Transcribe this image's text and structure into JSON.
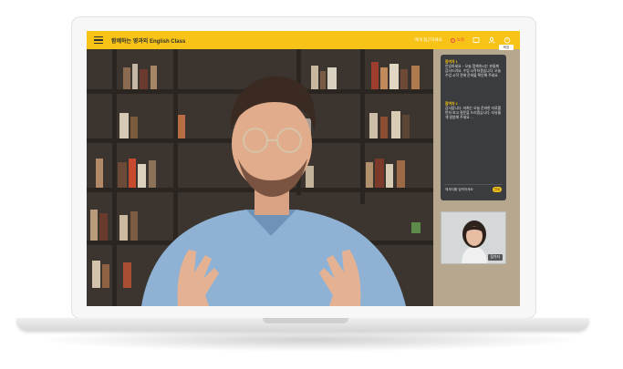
{
  "app": {
    "title": "함께하는 영과외 English Class",
    "menu_icon": "hamburger-menu-icon"
  },
  "topbar": {
    "status_text": "에게 접근하세요",
    "record_label": "녹화",
    "icons": [
      "screen-share-icon",
      "user-icon",
      "power-icon"
    ],
    "exit_label": "퇴장"
  },
  "chat": {
    "messages": [
      {
        "name": "참여자 1",
        "text": "안녕하세요 ~ 오늘 함께하시는 분들께 감사드려요. 수업 시작하겠습니다. 오늘 수업 시작 전에 준비물 확인해 주세요."
      },
      {
        "name": "참여자 2",
        "text": "감사합니다. 저희는 오늘 준비한 자료를 먼저 보고 질문을 드리겠습니다. 자유롭게 말씀해 주세요 ..."
      }
    ],
    "input_placeholder": "메세지를 입력하세요",
    "send_label": "전송"
  },
  "pip": {
    "participant_name": "참가자"
  },
  "colors": {
    "accent": "#f6c316",
    "chat_bg": "#3a3c3f"
  }
}
